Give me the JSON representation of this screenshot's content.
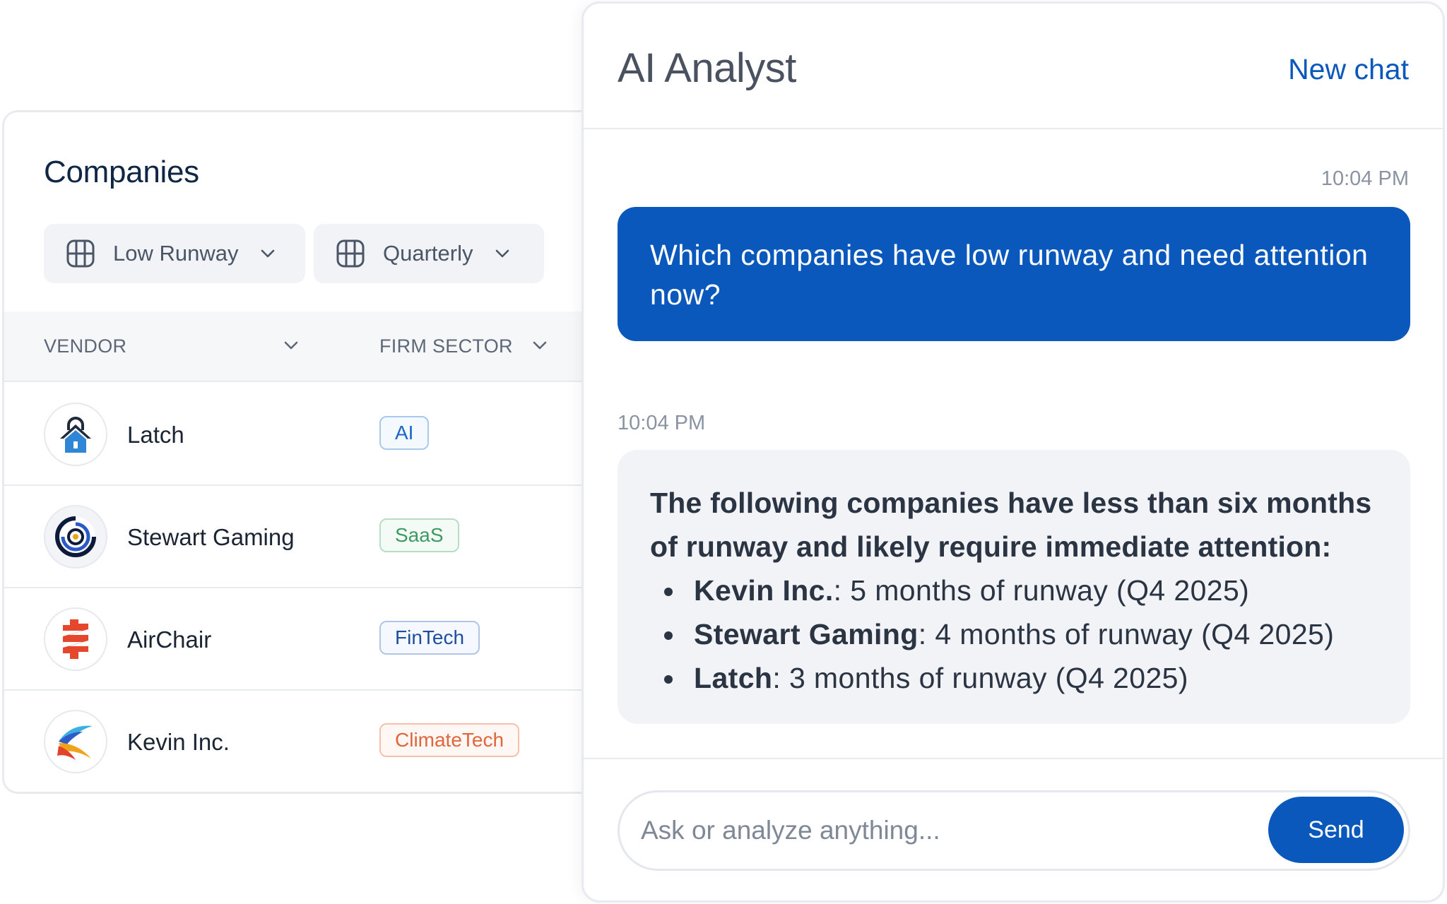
{
  "companies": {
    "title": "Companies",
    "filters": [
      {
        "label": "Low Runway",
        "icon": "table-grid-icon"
      },
      {
        "label": "Quarterly",
        "icon": "table-grid-icon"
      }
    ],
    "columns": {
      "vendor": "VENDOR",
      "sector": "FIRM SECTOR"
    },
    "rows": [
      {
        "name": "Latch",
        "sector": "AI",
        "sector_color": "#1a66c7",
        "sector_bg": "#f4f9ff",
        "sector_border": "#a9c9ec",
        "logo": "lock-house-logo"
      },
      {
        "name": "Stewart Gaming",
        "sector": "SaaS",
        "sector_color": "#3e9a63",
        "sector_bg": "#f4fbf6",
        "sector_border": "#b6dec4",
        "logo": "spiral-target-logo"
      },
      {
        "name": "AirChair",
        "sector": "FinTech",
        "sector_color": "#1d4f9e",
        "sector_bg": "#f5f8fe",
        "sector_border": "#b1c5e6",
        "logo": "red-zigzag-logo"
      },
      {
        "name": "Kevin Inc.",
        "sector": "ClimateTech",
        "sector_color": "#e0663d",
        "sector_bg": "#fff7f3",
        "sector_border": "#f3c1ac",
        "logo": "swoosh-k-logo"
      }
    ]
  },
  "analyst": {
    "title": "AI Analyst",
    "new_chat": "New chat",
    "messages": {
      "user_time": "10:04 PM",
      "user_text": "Which companies have low runway and need attention now?",
      "ai_time": "10:04 PM",
      "ai_intro": "The following companies have less than six months of runway and likely require immediate attention:",
      "ai_items": [
        {
          "company": "Kevin Inc.",
          "detail": ": 5 months of runway (Q4 2025)"
        },
        {
          "company": "Stewart Gaming",
          "detail": ": 4 months of runway (Q4 2025)"
        },
        {
          "company": "Latch",
          "detail": ": 3 months of runway (Q4 2025)"
        }
      ]
    },
    "input": {
      "placeholder": "Ask or analyze anything...",
      "value": ""
    },
    "send_label": "Send"
  },
  "colors": {
    "primary": "#0b58bc",
    "title_navy": "#0f2744",
    "ai_bubble": "#f1f3f7"
  }
}
